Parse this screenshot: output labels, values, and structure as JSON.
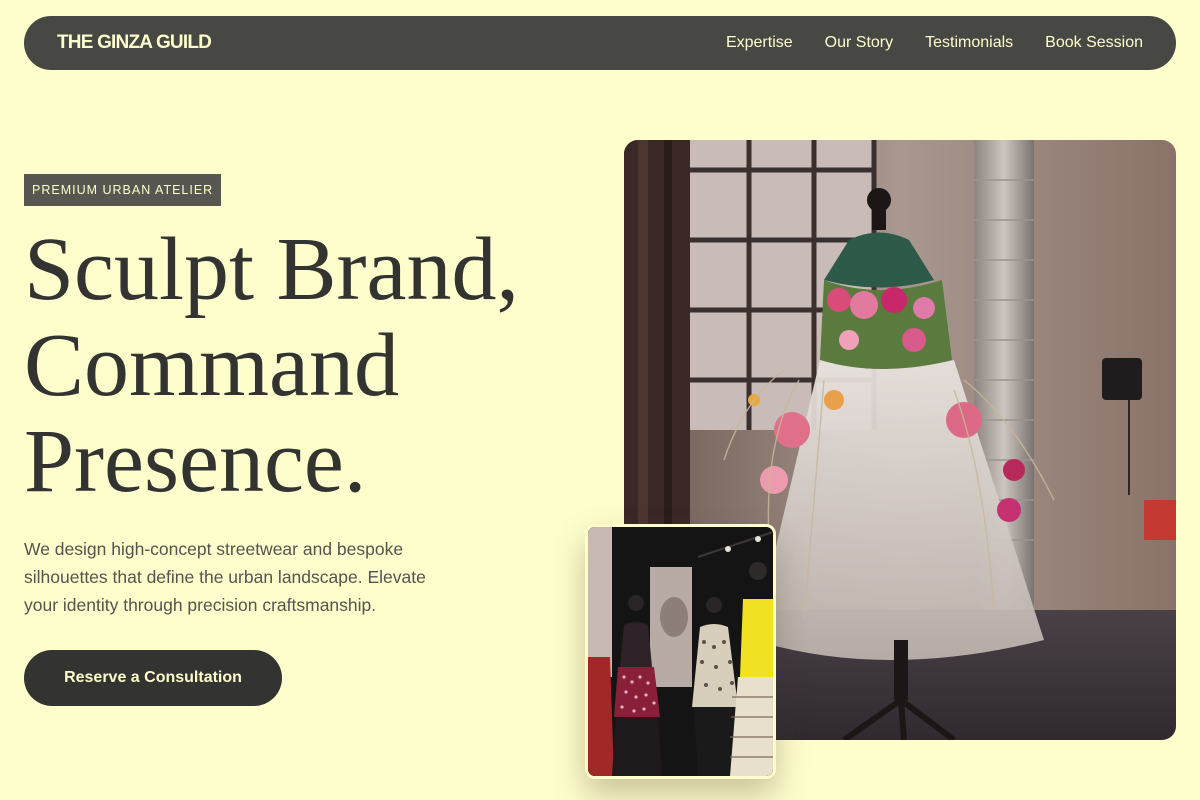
{
  "nav": {
    "brand": "THE GINZA GUILD",
    "links": [
      "Expertise",
      "Our Story",
      "Testimonials",
      "Book Session"
    ]
  },
  "hero": {
    "badge": "PREMIUM URBAN ATELIER",
    "headline": [
      "Sculpt Brand,",
      "Command",
      "Presence."
    ],
    "lede": "We design high-concept streetwear and bespoke silhouettes that define the urban landscape. Elevate your identity through precision craftsmanship.",
    "cta": "Reserve a Consultation"
  },
  "colors": {
    "background": "#fefdcc",
    "nav": "#474744",
    "badge": "#575651",
    "text": "#333331",
    "accent_text": "#fefdcc"
  }
}
